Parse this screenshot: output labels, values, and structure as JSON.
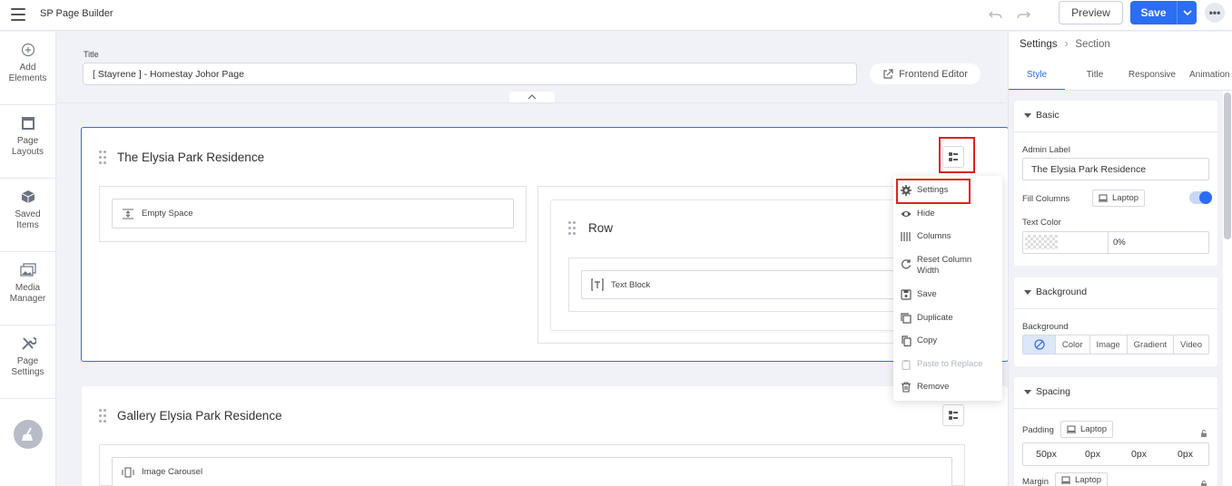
{
  "app": {
    "title": "SP Page Builder"
  },
  "toolbar": {
    "preview_label": "Preview",
    "save_label": "Save",
    "more_label": "•••"
  },
  "sidebar": {
    "items": [
      {
        "label_line1": "Add",
        "label_line2": "Elements",
        "icon": "plus-circle-icon"
      },
      {
        "label_line1": "Page",
        "label_line2": "Layouts",
        "icon": "layout-icon"
      },
      {
        "label_line1": "Saved",
        "label_line2": "Items",
        "icon": "cube-icon"
      },
      {
        "label_line1": "Media",
        "label_line2": "Manager",
        "icon": "images-icon"
      },
      {
        "label_line1": "Page",
        "label_line2": "Settings",
        "icon": "tools-icon"
      }
    ]
  },
  "editor": {
    "title_label": "Title",
    "title_value": "[ Stayrene ] - Homestay Johor Page",
    "frontend_editor_label": "Frontend Editor"
  },
  "sections": [
    {
      "title": "The Elysia Park Residence",
      "columns": [
        {
          "addons": [
            "Empty Space"
          ]
        },
        {
          "row_title": "Row",
          "addons": [
            "Text Block"
          ]
        }
      ]
    },
    {
      "title": "Gallery Elysia Park Residence",
      "addons": [
        "Image Carousel"
      ]
    }
  ],
  "context_menu": {
    "items": [
      {
        "label": "Settings",
        "icon": "gear-icon",
        "enabled": true
      },
      {
        "label": "Hide",
        "icon": "eye-icon",
        "enabled": true
      },
      {
        "label": "Columns",
        "icon": "columns-icon",
        "enabled": true
      },
      {
        "label_line1": "Reset Column",
        "label_line2": "Width",
        "icon": "reset-icon",
        "enabled": true
      },
      {
        "label": "Save",
        "icon": "save-icon",
        "enabled": true
      },
      {
        "label": "Duplicate",
        "icon": "duplicate-icon",
        "enabled": true
      },
      {
        "label": "Copy",
        "icon": "copy-icon",
        "enabled": true
      },
      {
        "label": "Paste to Replace",
        "icon": "clipboard-icon",
        "enabled": false
      },
      {
        "label": "Remove",
        "icon": "trash-icon",
        "enabled": true
      }
    ]
  },
  "settings_panel": {
    "breadcrumb": {
      "root": "Settings",
      "current": "Section"
    },
    "tabs": [
      "Style",
      "Title",
      "Responsive",
      "Animation"
    ],
    "active_tab": "Style",
    "basic": {
      "heading": "Basic",
      "admin_label_label": "Admin Label",
      "admin_label_value": "The Elysia Park Residence",
      "fill_columns_label": "Fill Columns",
      "fill_columns_device": "Laptop",
      "fill_columns_enabled": true,
      "text_color_label": "Text Color",
      "text_color_opacity": "0%"
    },
    "background": {
      "heading": "Background",
      "label": "Background",
      "options": [
        "Color",
        "Image",
        "Gradient",
        "Video"
      ],
      "selected": "none"
    },
    "spacing": {
      "heading": "Spacing",
      "padding_label": "Padding",
      "padding_device": "Laptop",
      "padding_values": [
        "50px",
        "0px",
        "0px",
        "0px"
      ],
      "margin_label": "Margin",
      "margin_device": "Laptop"
    }
  },
  "colors": {
    "accent": "#2c6ef2",
    "highlight": "#e02020",
    "canvas_bg": "#f0f2f7"
  }
}
